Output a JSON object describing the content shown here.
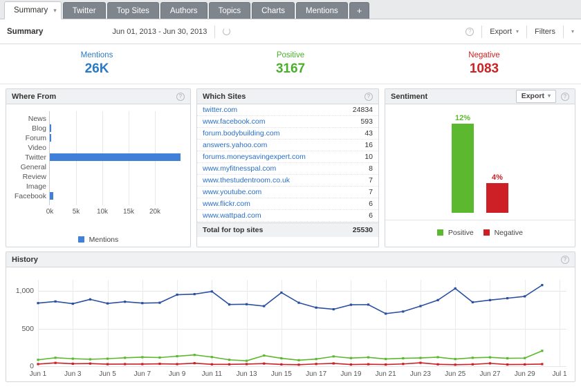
{
  "tabs": [
    {
      "label": "Summary",
      "active": true,
      "caret": true
    },
    {
      "label": "Twitter",
      "active": false
    },
    {
      "label": "Top Sites",
      "active": false
    },
    {
      "label": "Authors",
      "active": false
    },
    {
      "label": "Topics",
      "active": false
    },
    {
      "label": "Charts",
      "active": false
    },
    {
      "label": "Mentions",
      "active": false
    },
    {
      "label": "+",
      "active": false,
      "plus": true
    }
  ],
  "subheader": {
    "title": "Summary",
    "date_range": "Jun 01, 2013 - Jun 30, 2013",
    "refresh_icon": "refresh-icon",
    "help_icon": "help-icon",
    "export_label": "Export",
    "filters_label": "Filters",
    "caret": "⌄"
  },
  "kpis": [
    {
      "label": "Mentions",
      "value": "26K",
      "color": "#2a7ac4",
      "key": "mentions"
    },
    {
      "label": "Positive",
      "value": "3167",
      "color": "#4caf2b",
      "key": "positive"
    },
    {
      "label": "Negative",
      "value": "1083",
      "color": "#cc2222",
      "key": "negative"
    }
  ],
  "where_from": {
    "title": "Where From",
    "legend_label": "Mentions",
    "help_icon": "help-icon"
  },
  "which_sites": {
    "title": "Which Sites",
    "help_icon": "help-icon",
    "total_label": "Total for top sites",
    "total_value": "25530",
    "rows": [
      {
        "site": "twitter.com",
        "count": "24834"
      },
      {
        "site": "www.facebook.com",
        "count": "593"
      },
      {
        "site": "forum.bodybuilding.com",
        "count": "43"
      },
      {
        "site": "answers.yahoo.com",
        "count": "16"
      },
      {
        "site": "forums.moneysavingexpert.com",
        "count": "10"
      },
      {
        "site": "www.myfitnesspal.com",
        "count": "8"
      },
      {
        "site": "www.thestudentroom.co.uk",
        "count": "7"
      },
      {
        "site": "www.youtube.com",
        "count": "7"
      },
      {
        "site": "www.flickr.com",
        "count": "6"
      },
      {
        "site": "www.wattpad.com",
        "count": "6"
      }
    ]
  },
  "sentiment": {
    "title": "Sentiment",
    "export_label": "Export",
    "help_icon": "help-icon"
  },
  "history": {
    "title": "History",
    "help_icon": "help-icon"
  },
  "chart_data": [
    {
      "type": "bar",
      "id": "where-from",
      "title": "Where From",
      "orientation": "horizontal",
      "categories": [
        "News",
        "Blog",
        "Forum",
        "Video",
        "Twitter",
        "General",
        "Review",
        "Image",
        "Facebook"
      ],
      "values": [
        0,
        120,
        110,
        0,
        24834,
        0,
        0,
        0,
        593
      ],
      "series_name": "Mentions",
      "color": "#4080d8",
      "xlabel": "",
      "ylabel": "",
      "xlim": [
        0,
        25000
      ],
      "xticks": [
        0,
        5000,
        10000,
        15000,
        20000
      ],
      "xtick_labels": [
        "0k",
        "5k",
        "10k",
        "15k",
        "20k"
      ],
      "grid": true,
      "legend": [
        "Mentions"
      ],
      "legend_position": "bottom"
    },
    {
      "type": "bar",
      "id": "sentiment",
      "title": "Sentiment",
      "orientation": "vertical",
      "categories": [
        "Positive",
        "Negative"
      ],
      "values": [
        12,
        4
      ],
      "value_labels": [
        "12%",
        "4%"
      ],
      "colors": [
        "#5cb82e",
        "#cc2026"
      ],
      "ylim": [
        0,
        13
      ],
      "ylabel": "",
      "grid": false,
      "legend": [
        "Positive",
        "Negative"
      ],
      "legend_position": "bottom"
    },
    {
      "type": "line",
      "id": "history",
      "title": "History",
      "x": [
        "Jun 1",
        "Jun 2",
        "Jun 3",
        "Jun 4",
        "Jun 5",
        "Jun 6",
        "Jun 7",
        "Jun 8",
        "Jun 9",
        "Jun 10",
        "Jun 11",
        "Jun 12",
        "Jun 13",
        "Jun 14",
        "Jun 15",
        "Jun 16",
        "Jun 17",
        "Jun 18",
        "Jun 19",
        "Jun 20",
        "Jun 21",
        "Jun 22",
        "Jun 23",
        "Jun 24",
        "Jun 25",
        "Jun 26",
        "Jun 27",
        "Jun 28",
        "Jun 29",
        "Jun 30"
      ],
      "xtick_labels": [
        "Jun 1",
        "Jun 3",
        "Jun 5",
        "Jun 7",
        "Jun 9",
        "Jun 11",
        "Jun 13",
        "Jun 15",
        "Jun 17",
        "Jun 19",
        "Jun 21",
        "Jun 23",
        "Jun 25",
        "Jun 27",
        "Jun 29",
        "Jul 1"
      ],
      "ylim": [
        0,
        1150
      ],
      "yticks": [
        0,
        500,
        1000
      ],
      "ytick_labels": [
        "0",
        "500",
        "1,000"
      ],
      "grid": true,
      "series": [
        {
          "name": "Mentions",
          "color": "#2b4fa0",
          "values": [
            840,
            862,
            832,
            890,
            836,
            858,
            840,
            845,
            952,
            960,
            995,
            822,
            825,
            800,
            980,
            845,
            780,
            758,
            818,
            820,
            700,
            728,
            800,
            880,
            1035,
            852,
            880,
            905,
            930,
            1080
          ]
        },
        {
          "name": "Positive",
          "color": "#5cb82e",
          "values": [
            85,
            112,
            100,
            92,
            100,
            112,
            120,
            115,
            133,
            150,
            122,
            85,
            72,
            142,
            105,
            80,
            95,
            130,
            108,
            118,
            96,
            105,
            110,
            120,
            95,
            112,
            118,
            105,
            108,
            205
          ]
        },
        {
          "name": "Negative",
          "color": "#cc2026",
          "values": [
            28,
            44,
            33,
            35,
            27,
            28,
            28,
            32,
            28,
            40,
            25,
            25,
            28,
            35,
            24,
            20,
            30,
            37,
            22,
            26,
            22,
            30,
            45,
            25,
            20,
            25,
            38,
            22,
            24,
            28
          ]
        }
      ]
    }
  ]
}
